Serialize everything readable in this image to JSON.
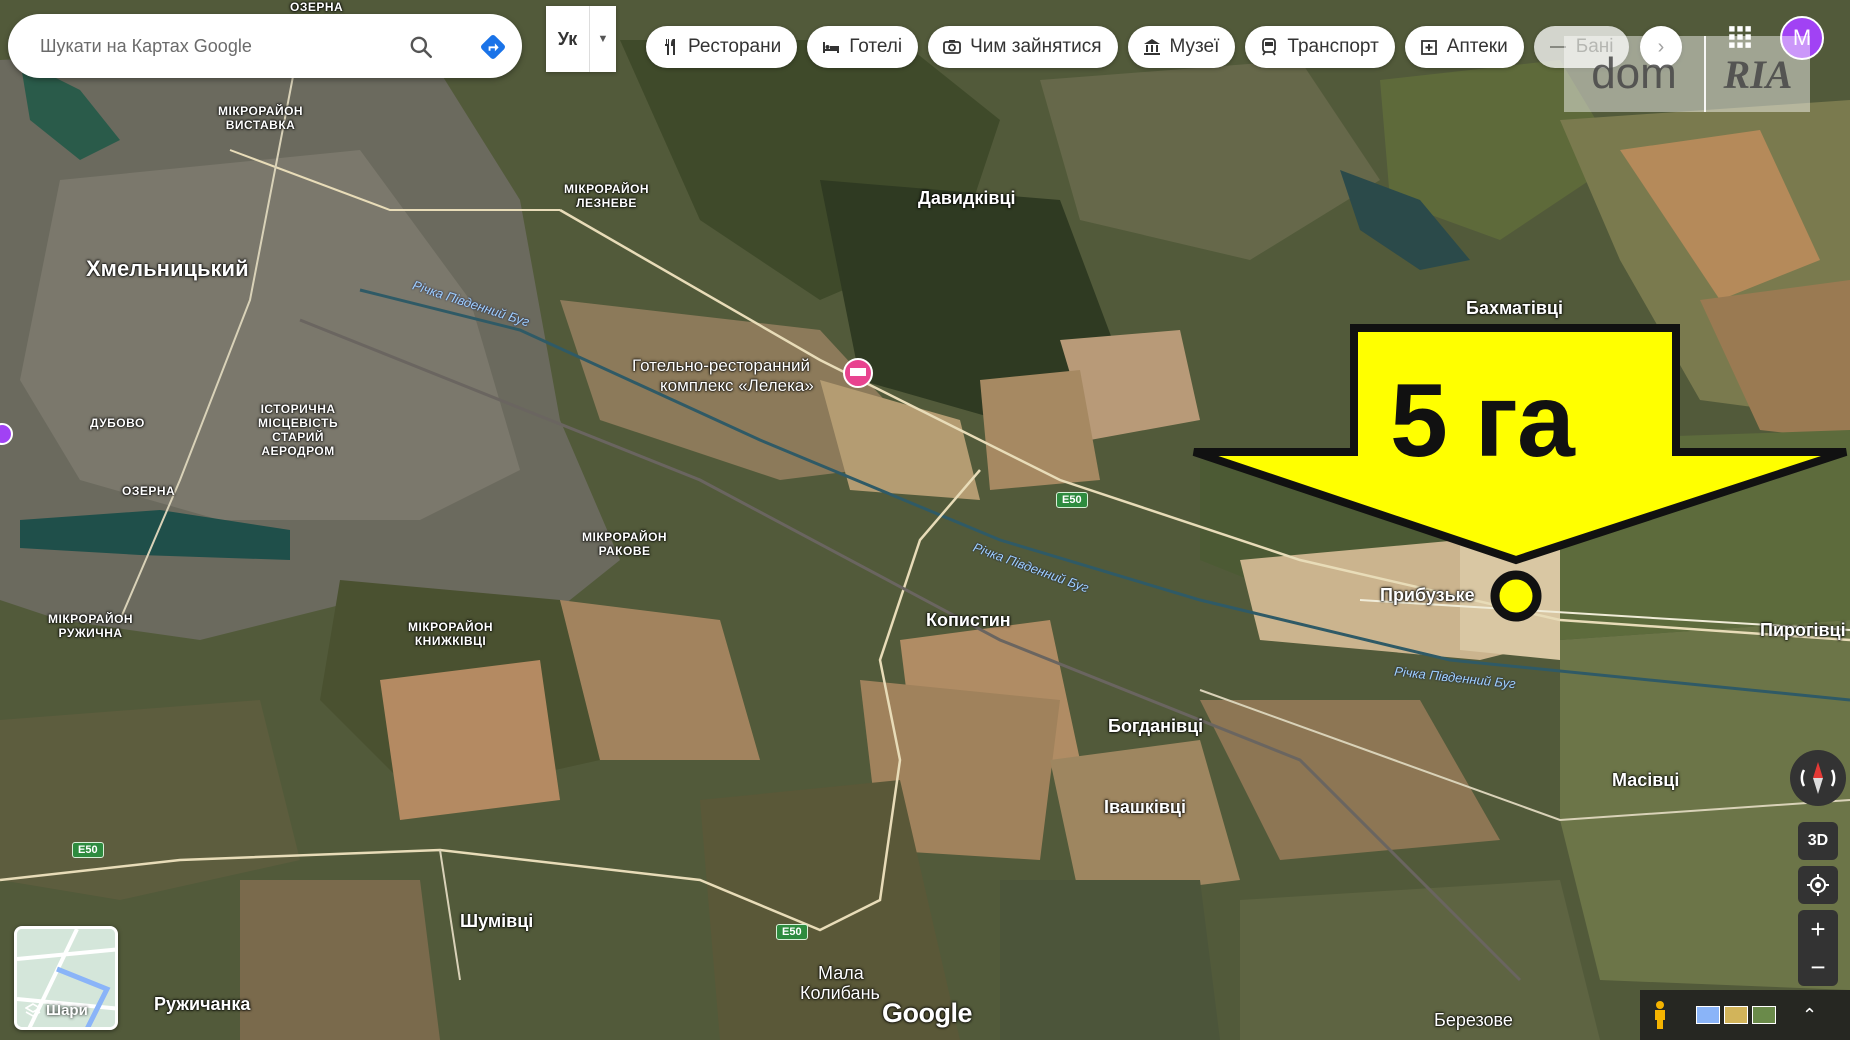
{
  "search": {
    "placeholder": "Шукати на Картах Google"
  },
  "language": {
    "code": "Ук"
  },
  "chips": [
    {
      "label": "Ресторани",
      "icon": "restaurant-icon"
    },
    {
      "label": "Готелі",
      "icon": "hotel-icon"
    },
    {
      "label": "Чим зайнятися",
      "icon": "camera-icon"
    },
    {
      "label": "Музеї",
      "icon": "museum-icon"
    },
    {
      "label": "Транспорт",
      "icon": "transit-icon"
    },
    {
      "label": "Аптеки",
      "icon": "pharmacy-icon"
    },
    {
      "label": "Бані",
      "icon": "atm-icon"
    }
  ],
  "account": {
    "initial": "M"
  },
  "watermark": {
    "left": "dom",
    "right": "RIA"
  },
  "layers": {
    "label": "Шари"
  },
  "google": {
    "logo": "Google"
  },
  "controls": {
    "three_d": "3D",
    "zoom_in": "+",
    "zoom_out": "−"
  },
  "overlay": {
    "area_label": "5 га"
  },
  "map": {
    "places": {
      "khmelnytskyi": "Хмельницький",
      "davydkivtsi": "Давидківці",
      "bakhmativtsi": "Бахматівці",
      "kopystyn": "Копистин",
      "prybuzke": "Прибузьке",
      "pyrohivtsi": "Пирогівці",
      "bohdanivtsi": "Богданівці",
      "ivashkivtsi": "Івашківці",
      "masivtsi": "Масівці",
      "shumivtsi": "Шумівці",
      "ruzhychanka": "Ружичанка",
      "mala_kolybain_1": "Мала",
      "mala_kolybain_2": "Колибань",
      "berezove": "Березове",
      "ozerna_top": "ОЗЕРНА"
    },
    "districts": {
      "vystavka": "МІКРОРАЙОН\nВИСТАВКА",
      "lezneve": "МІКРОРАЙОН\nЛЕЗНЕВЕ",
      "dubovo": "ДУБОВО",
      "ozerna": "ОЗЕРНА",
      "aerodrom": "ІСТОРИЧНА\nМІСЦЕВІСТЬ\nСТАРИЙ\nАЕРОДРОМ",
      "rakove": "МІКРОРАЙОН\nРАКОВЕ",
      "ruzhychna": "МІКРОРАЙОН\nРУЖИЧНА",
      "knyzhkivtsi": "МІКРОРАЙОН\nКНИЖКІВЦІ"
    },
    "poi": {
      "line1": "Готельно-ресторанний",
      "line2": "комплекс «Лелека»"
    },
    "rivers": {
      "label": "Річка Південний Буг"
    },
    "roads": {
      "e50": "E50"
    }
  }
}
